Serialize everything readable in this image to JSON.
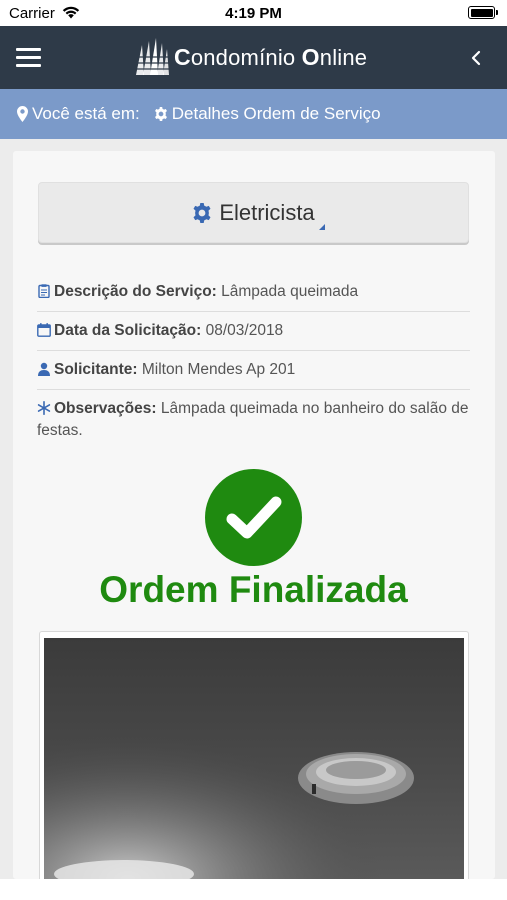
{
  "status_bar": {
    "carrier": "Carrier",
    "time": "4:19 PM"
  },
  "app": {
    "title_first": "C",
    "title_rest1": "ondomínio ",
    "title_second": "O",
    "title_rest2": "nline"
  },
  "breadcrumb": {
    "prefix": "Você está em:",
    "current": "Detalhes Ordem de Serviço"
  },
  "service": {
    "category": "Eletricista",
    "fields": [
      {
        "label": "Descrição do Serviço:",
        "value": " Lâmpada queimada",
        "icon": "clipboard-icon"
      },
      {
        "label": "Data da Solicitação:",
        "value": " 08/03/2018",
        "icon": "calendar-icon"
      },
      {
        "label": "Solicitante:",
        "value": " Milton Mendes Ap 201",
        "icon": "user-icon"
      },
      {
        "label": "Observações:",
        "value": " Lâmpada queimada no banheiro do salão de festas.",
        "icon": "asterisk-icon"
      }
    ],
    "status": "Ordem Finalizada",
    "status_color": "#1f8a10"
  },
  "colors": {
    "navbar": "#2e3a48",
    "breadcrumb": "#7b9ac9",
    "accent": "#3a69b3"
  }
}
